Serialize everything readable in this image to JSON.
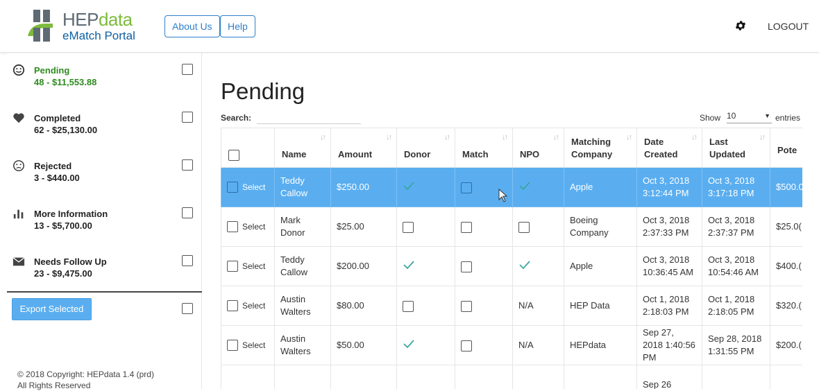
{
  "header": {
    "logo_title_main": "HEP",
    "logo_title_accent": "data",
    "logo_subtitle": "eMatch Portal",
    "about_label": "About Us",
    "help_label": "Help",
    "logout_label": "LOGOUT"
  },
  "sidebar": {
    "items": [
      {
        "label": "Pending",
        "value": "48 - $11,553.88",
        "icon": "smile-icon"
      },
      {
        "label": "Completed",
        "value": "62 - $25,130.00",
        "icon": "heart-icon"
      },
      {
        "label": "Rejected",
        "value": "3 - $440.00",
        "icon": "frown-icon"
      },
      {
        "label": "More Information",
        "value": "13 - $5,700.00",
        "icon": "bar-chart-icon"
      },
      {
        "label": "Needs Follow Up",
        "value": "23 - $9,475.00",
        "icon": "envelope-icon"
      }
    ],
    "export_label": "Export Selected",
    "copyright_line1": "© 2018 Copyright: HEPdata 1.4 (prd)",
    "copyright_line2": "All Rights Reserved"
  },
  "main": {
    "title": "Pending",
    "search_label": "Search:",
    "show_label": "Show",
    "show_value": "10",
    "entries_label": "entries",
    "columns": [
      "Name",
      "Amount",
      "Donor",
      "Match",
      "NPO",
      "Matching Company",
      "Date Created",
      "Last Updated",
      "Pote"
    ],
    "select_label": "Select",
    "rows": [
      {
        "selected": true,
        "name": "Teddy Callow",
        "amount": "$250.00",
        "donor": "check",
        "match": "box",
        "npo": "check",
        "company": "Apple",
        "created": "Oct 3, 2018 3:12:44 PM",
        "updated": "Oct 3, 2018 3:17:18 PM",
        "potential": "$500.0"
      },
      {
        "selected": false,
        "name": "Mark Donor",
        "amount": "$25.00",
        "donor": "box",
        "match": "box",
        "npo": "box",
        "company": "Boeing Company",
        "created": "Oct 3, 2018 2:37:33 PM",
        "updated": "Oct 3, 2018 2:37:37 PM",
        "potential": "$25.0("
      },
      {
        "selected": false,
        "name": "Teddy Callow",
        "amount": "$200.00",
        "donor": "check",
        "match": "box",
        "npo": "check",
        "company": "Apple",
        "created": "Oct 3, 2018 10:36:45 AM",
        "updated": "Oct 3, 2018 10:54:46 AM",
        "potential": "$400.("
      },
      {
        "selected": false,
        "name": "Austin Walters",
        "amount": "$80.00",
        "donor": "box",
        "match": "box",
        "npo": "N/A",
        "company": "HEP Data",
        "created": "Oct 1, 2018 2:18:03 PM",
        "updated": "Oct 1, 2018 2:18:05 PM",
        "potential": "$320.("
      },
      {
        "selected": false,
        "name": "Austin Walters",
        "amount": "$50.00",
        "donor": "check",
        "match": "box",
        "npo": "N/A",
        "company": "HEPdata",
        "created": "Sep 27, 2018 1:40:56 PM",
        "updated": "Sep 28, 2018 1:31:55 PM",
        "potential": "$200.("
      },
      {
        "selected": false,
        "name": "",
        "amount": "",
        "donor": "",
        "match": "",
        "npo": "",
        "company": "",
        "created": "Sep 26",
        "updated": "",
        "potential": ""
      }
    ]
  },
  "colors": {
    "accent": "#5aaef0",
    "active_green": "#2e8b1f",
    "check_teal": "#3aa6a0",
    "brand_blue": "#0e5fa3"
  }
}
